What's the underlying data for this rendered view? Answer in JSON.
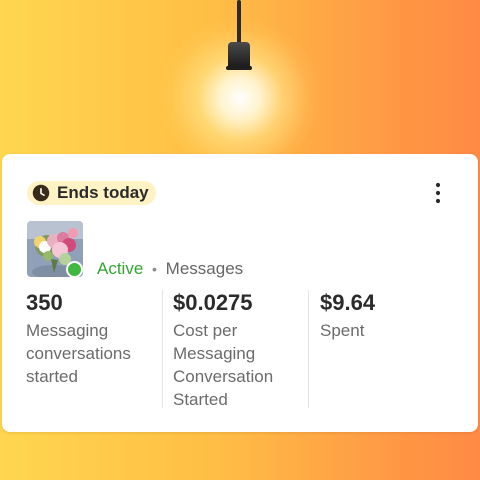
{
  "header_visual": {
    "name": "light-bulb"
  },
  "card": {
    "badge": {
      "label": "Ends today",
      "icon": "clock-icon",
      "background": "#fff2c4"
    },
    "menu_icon": "more-vertical-icon",
    "campaign": {
      "thumbnail": "flower-bouquet-thumbnail",
      "status": "Active",
      "status_color": "#3fb83f",
      "separator": "•",
      "objective": "Messages"
    },
    "metrics": [
      {
        "value": "350",
        "label": "Messaging conversations started"
      },
      {
        "value": "$0.0275",
        "label": "Cost per Messaging Conversation Started"
      },
      {
        "value": "$9.64",
        "label": "Spent"
      }
    ]
  }
}
